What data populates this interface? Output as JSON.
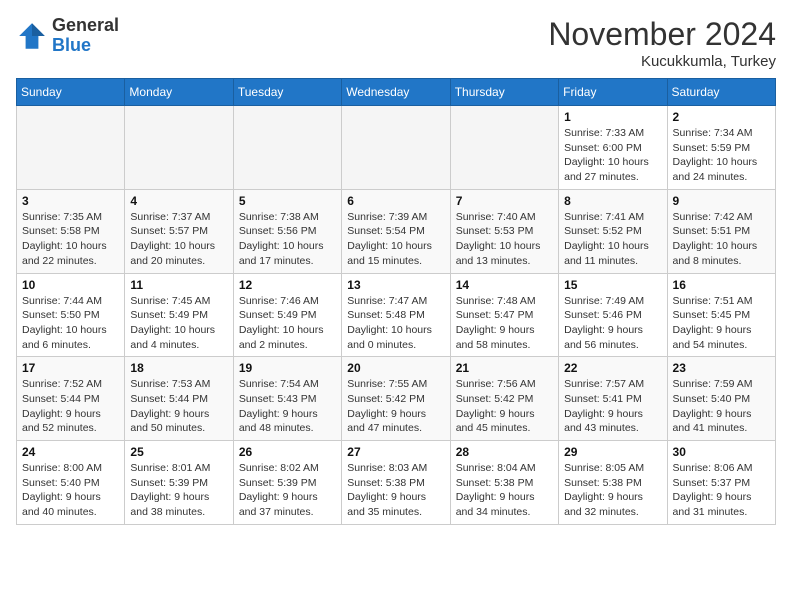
{
  "header": {
    "logo_general": "General",
    "logo_blue": "Blue",
    "month_title": "November 2024",
    "location": "Kucukkumla, Turkey"
  },
  "weekdays": [
    "Sunday",
    "Monday",
    "Tuesday",
    "Wednesday",
    "Thursday",
    "Friday",
    "Saturday"
  ],
  "weeks": [
    [
      {
        "day": "",
        "empty": true
      },
      {
        "day": "",
        "empty": true
      },
      {
        "day": "",
        "empty": true
      },
      {
        "day": "",
        "empty": true
      },
      {
        "day": "",
        "empty": true
      },
      {
        "day": "1",
        "sunrise": "Sunrise: 7:33 AM",
        "sunset": "Sunset: 6:00 PM",
        "daylight": "Daylight: 10 hours and 27 minutes."
      },
      {
        "day": "2",
        "sunrise": "Sunrise: 7:34 AM",
        "sunset": "Sunset: 5:59 PM",
        "daylight": "Daylight: 10 hours and 24 minutes."
      }
    ],
    [
      {
        "day": "3",
        "sunrise": "Sunrise: 7:35 AM",
        "sunset": "Sunset: 5:58 PM",
        "daylight": "Daylight: 10 hours and 22 minutes."
      },
      {
        "day": "4",
        "sunrise": "Sunrise: 7:37 AM",
        "sunset": "Sunset: 5:57 PM",
        "daylight": "Daylight: 10 hours and 20 minutes."
      },
      {
        "day": "5",
        "sunrise": "Sunrise: 7:38 AM",
        "sunset": "Sunset: 5:56 PM",
        "daylight": "Daylight: 10 hours and 17 minutes."
      },
      {
        "day": "6",
        "sunrise": "Sunrise: 7:39 AM",
        "sunset": "Sunset: 5:54 PM",
        "daylight": "Daylight: 10 hours and 15 minutes."
      },
      {
        "day": "7",
        "sunrise": "Sunrise: 7:40 AM",
        "sunset": "Sunset: 5:53 PM",
        "daylight": "Daylight: 10 hours and 13 minutes."
      },
      {
        "day": "8",
        "sunrise": "Sunrise: 7:41 AM",
        "sunset": "Sunset: 5:52 PM",
        "daylight": "Daylight: 10 hours and 11 minutes."
      },
      {
        "day": "9",
        "sunrise": "Sunrise: 7:42 AM",
        "sunset": "Sunset: 5:51 PM",
        "daylight": "Daylight: 10 hours and 8 minutes."
      }
    ],
    [
      {
        "day": "10",
        "sunrise": "Sunrise: 7:44 AM",
        "sunset": "Sunset: 5:50 PM",
        "daylight": "Daylight: 10 hours and 6 minutes."
      },
      {
        "day": "11",
        "sunrise": "Sunrise: 7:45 AM",
        "sunset": "Sunset: 5:49 PM",
        "daylight": "Daylight: 10 hours and 4 minutes."
      },
      {
        "day": "12",
        "sunrise": "Sunrise: 7:46 AM",
        "sunset": "Sunset: 5:49 PM",
        "daylight": "Daylight: 10 hours and 2 minutes."
      },
      {
        "day": "13",
        "sunrise": "Sunrise: 7:47 AM",
        "sunset": "Sunset: 5:48 PM",
        "daylight": "Daylight: 10 hours and 0 minutes."
      },
      {
        "day": "14",
        "sunrise": "Sunrise: 7:48 AM",
        "sunset": "Sunset: 5:47 PM",
        "daylight": "Daylight: 9 hours and 58 minutes."
      },
      {
        "day": "15",
        "sunrise": "Sunrise: 7:49 AM",
        "sunset": "Sunset: 5:46 PM",
        "daylight": "Daylight: 9 hours and 56 minutes."
      },
      {
        "day": "16",
        "sunrise": "Sunrise: 7:51 AM",
        "sunset": "Sunset: 5:45 PM",
        "daylight": "Daylight: 9 hours and 54 minutes."
      }
    ],
    [
      {
        "day": "17",
        "sunrise": "Sunrise: 7:52 AM",
        "sunset": "Sunset: 5:44 PM",
        "daylight": "Daylight: 9 hours and 52 minutes."
      },
      {
        "day": "18",
        "sunrise": "Sunrise: 7:53 AM",
        "sunset": "Sunset: 5:44 PM",
        "daylight": "Daylight: 9 hours and 50 minutes."
      },
      {
        "day": "19",
        "sunrise": "Sunrise: 7:54 AM",
        "sunset": "Sunset: 5:43 PM",
        "daylight": "Daylight: 9 hours and 48 minutes."
      },
      {
        "day": "20",
        "sunrise": "Sunrise: 7:55 AM",
        "sunset": "Sunset: 5:42 PM",
        "daylight": "Daylight: 9 hours and 47 minutes."
      },
      {
        "day": "21",
        "sunrise": "Sunrise: 7:56 AM",
        "sunset": "Sunset: 5:42 PM",
        "daylight": "Daylight: 9 hours and 45 minutes."
      },
      {
        "day": "22",
        "sunrise": "Sunrise: 7:57 AM",
        "sunset": "Sunset: 5:41 PM",
        "daylight": "Daylight: 9 hours and 43 minutes."
      },
      {
        "day": "23",
        "sunrise": "Sunrise: 7:59 AM",
        "sunset": "Sunset: 5:40 PM",
        "daylight": "Daylight: 9 hours and 41 minutes."
      }
    ],
    [
      {
        "day": "24",
        "sunrise": "Sunrise: 8:00 AM",
        "sunset": "Sunset: 5:40 PM",
        "daylight": "Daylight: 9 hours and 40 minutes."
      },
      {
        "day": "25",
        "sunrise": "Sunrise: 8:01 AM",
        "sunset": "Sunset: 5:39 PM",
        "daylight": "Daylight: 9 hours and 38 minutes."
      },
      {
        "day": "26",
        "sunrise": "Sunrise: 8:02 AM",
        "sunset": "Sunset: 5:39 PM",
        "daylight": "Daylight: 9 hours and 37 minutes."
      },
      {
        "day": "27",
        "sunrise": "Sunrise: 8:03 AM",
        "sunset": "Sunset: 5:38 PM",
        "daylight": "Daylight: 9 hours and 35 minutes."
      },
      {
        "day": "28",
        "sunrise": "Sunrise: 8:04 AM",
        "sunset": "Sunset: 5:38 PM",
        "daylight": "Daylight: 9 hours and 34 minutes."
      },
      {
        "day": "29",
        "sunrise": "Sunrise: 8:05 AM",
        "sunset": "Sunset: 5:38 PM",
        "daylight": "Daylight: 9 hours and 32 minutes."
      },
      {
        "day": "30",
        "sunrise": "Sunrise: 8:06 AM",
        "sunset": "Sunset: 5:37 PM",
        "daylight": "Daylight: 9 hours and 31 minutes."
      }
    ]
  ]
}
